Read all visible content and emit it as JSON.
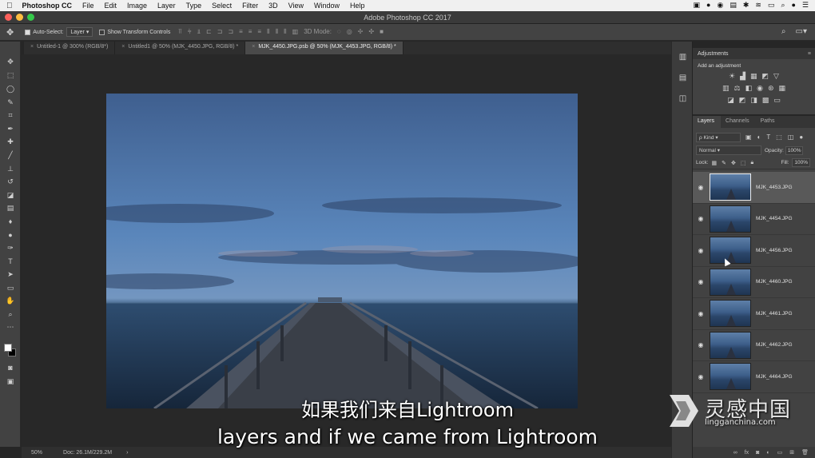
{
  "menubar": {
    "apple": "",
    "app": "Photoshop CC",
    "items": [
      "File",
      "Edit",
      "Image",
      "Layer",
      "Type",
      "Select",
      "Filter",
      "3D",
      "View",
      "Window",
      "Help"
    ]
  },
  "window": {
    "title": "Adobe Photoshop CC 2017"
  },
  "options": {
    "auto_select_label": "Auto-Select:",
    "auto_select_value": "Layer",
    "show_transform_label": "Show Transform Controls",
    "mode_3d_label": "3D Mode:"
  },
  "tabs": [
    {
      "label": "Untitled-1 @ 300% (RGB/8*)"
    },
    {
      "label": "Untitled1 @ 50% (MJK_4450.JPG, RGB/8) *"
    },
    {
      "label": "MJK_4450.JPG.psb @ 50% (MJK_4453.JPG, RGB/8) *"
    }
  ],
  "status": {
    "zoom": "50%",
    "doc": "Doc: 26.1M/229.2M",
    "arrow": "›"
  },
  "subtitles": {
    "zh": "如果我们来自Lightroom",
    "en": "layers and if we came from Lightroom"
  },
  "adjustments": {
    "title": "Adjustments",
    "subtitle": "Add an adjustment"
  },
  "layers_panel": {
    "tabs": [
      "Layers",
      "Channels",
      "Paths"
    ],
    "kind_label": "ρ Kind",
    "blend_mode": "Normal",
    "opacity_label": "Opacity:",
    "opacity_value": "100%",
    "lock_label": "Lock:",
    "fill_label": "Fill:",
    "fill_value": "100%",
    "layers": [
      {
        "name": "MJK_4453.JPG",
        "selected": true
      },
      {
        "name": "MJK_4454.JPG",
        "selected": false
      },
      {
        "name": "MJK_4456.JPG",
        "selected": false
      },
      {
        "name": "MJK_4460.JPG",
        "selected": false
      },
      {
        "name": "MJK_4461.JPG",
        "selected": false
      },
      {
        "name": "MJK_4462.JPG",
        "selected": false
      },
      {
        "name": "MJK_4464.JPG",
        "selected": false
      }
    ]
  },
  "watermark": {
    "text": "灵感中国",
    "url": "lingganchina.com"
  },
  "colors": {
    "accent_bg": "#424242",
    "selected_layer": "#595959",
    "canvas_bg": "#282828"
  },
  "icons": {
    "tools": [
      "move-icon",
      "marquee-icon",
      "lasso-icon",
      "quick-select-icon",
      "crop-icon",
      "eyedropper-icon",
      "healing-brush-icon",
      "brush-icon",
      "clone-stamp-icon",
      "history-brush-icon",
      "eraser-icon",
      "gradient-icon",
      "blur-icon",
      "dodge-icon",
      "pen-icon",
      "type-icon",
      "path-select-icon",
      "rectangle-icon",
      "hand-icon",
      "zoom-icon",
      "more-icon"
    ]
  }
}
